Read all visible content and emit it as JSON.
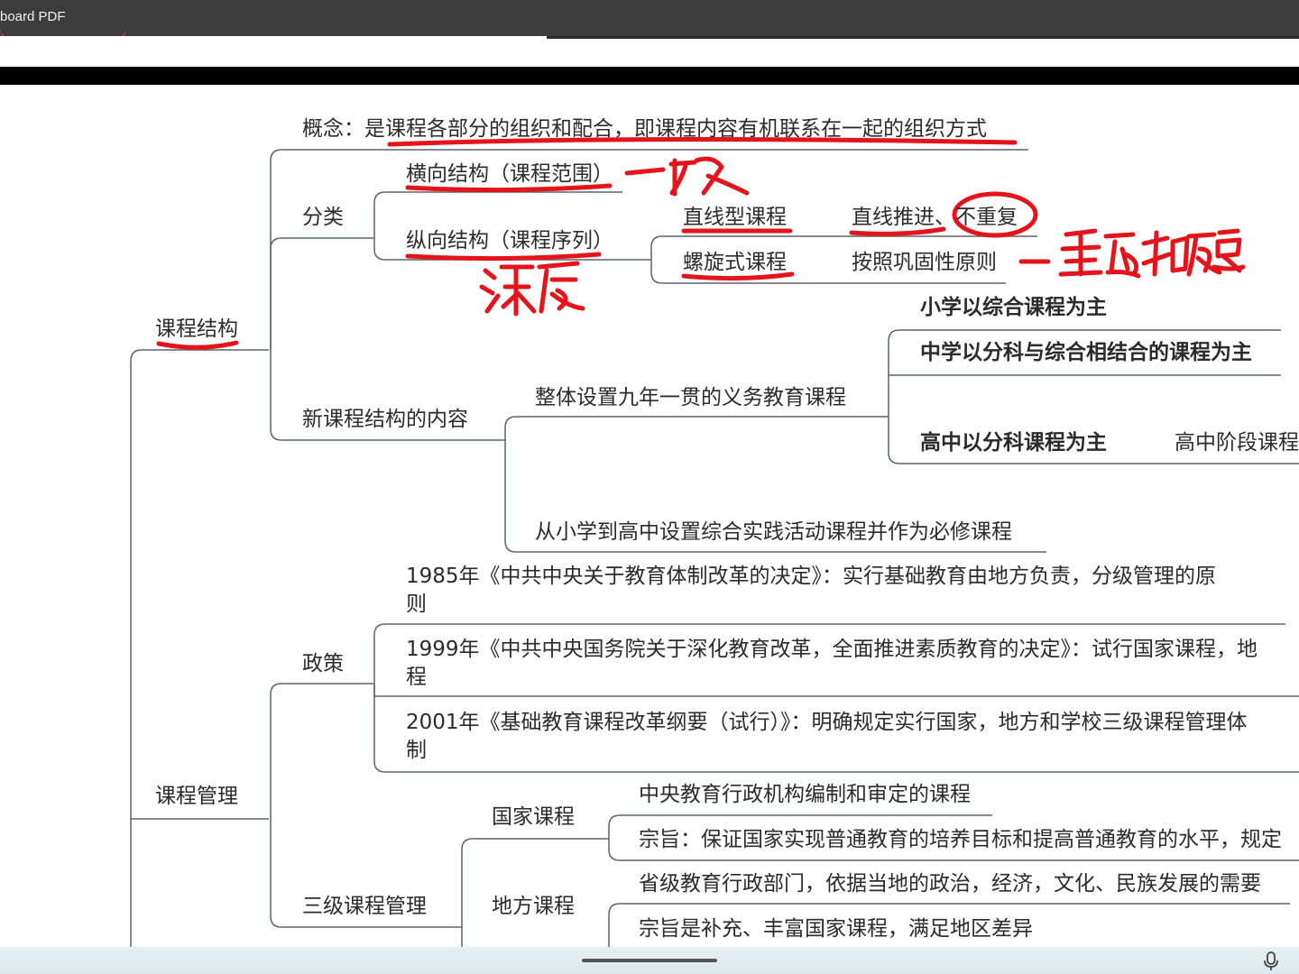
{
  "window": {
    "title": "board PDF"
  },
  "mindmap": {
    "root1": "课程结构",
    "concept": "概念：是课程各部分的组织和配合，即课程内容有机联系在一起的组织方式",
    "classify": "分类",
    "horizontal": "横向结构（课程范围）",
    "vertical": "纵向结构（课程序列）",
    "linear": "直线型课程",
    "linear_desc": "直线推进、不重复",
    "spiral": "螺旋式课程",
    "spiral_desc": "按照巩固性原则",
    "new_structure": "新课程结构的内容",
    "nine_year": "整体设置九年一贯的义务教育课程",
    "primary": "小学以综合课程为主",
    "middle": "中学以分科与综合相结合的课程为主",
    "high": "高中以分科课程为主",
    "high_desc": "高中阶段课程",
    "practice": "从小学到高中设置综合实践活动课程并作为必修课程",
    "root2": "课程管理",
    "policy": "政策",
    "policy_1985": "1985年《中共中央关于教育体制改革的决定》：实行基础教育由地方负责，分级管理的原",
    "policy_1985_b": "则",
    "policy_1999": "1999年《中共中央国务院关于深化教育改革，全面推进素质教育的决定》：试行国家课程，地",
    "policy_1999_b": "程",
    "policy_2001": "2001年《基础教育课程改革纲要（试行）》：明确规定实行国家，地方和学校三级课程管理体",
    "policy_2001_b": "制",
    "three_level": "三级课程管理",
    "national": "国家课程",
    "national_1": "中央教育行政机构编制和审定的课程",
    "national_2": "宗旨：保证国家实现普通教育的培养目标和提高普通教育的水平，规定",
    "local": "地方课程",
    "local_1": "省级教育行政部门，依据当地的政治，经济，文化、民族发展的需要",
    "local_2": "宗旨是补充、丰富国家课程，满足地区差异"
  },
  "annotations": {
    "breadth": "广度",
    "depth": "深度",
    "repeat": "重复和反复",
    "ink_color": "#e5141b"
  },
  "colors": {
    "line": "#5a6470",
    "text": "#2b2b2b",
    "ink": "#e5141b"
  }
}
